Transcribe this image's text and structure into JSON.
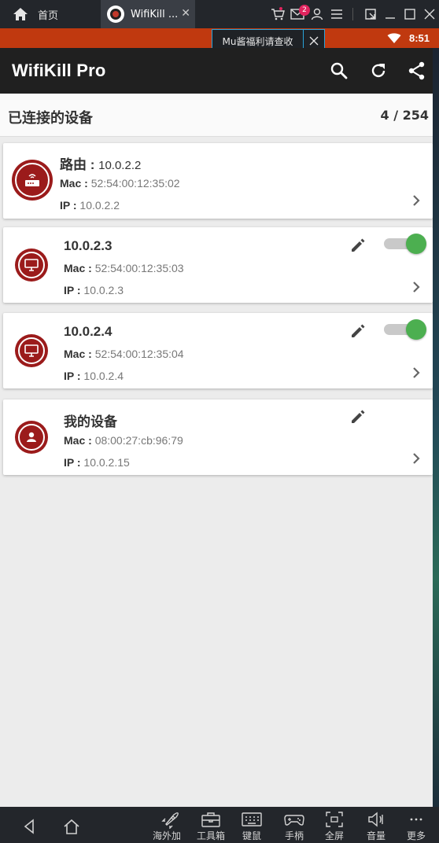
{
  "emulator": {
    "home_tab_label": "首页",
    "app_tab_label": "WifiKill ...",
    "mail_badge": "2",
    "promo_text": "Mu酱福利请查收"
  },
  "status_bar": {
    "time": "8:51"
  },
  "toolbar": {
    "title": "WifiKill Pro"
  },
  "section": {
    "title": "已连接的设备",
    "count": "4 / 254"
  },
  "devices": [
    {
      "title_label": "路由 : ",
      "title": "10.0.2.2",
      "mac_label": "Mac : ",
      "mac": "52:54:00:12:35:02",
      "ip_label": "IP : ",
      "ip": "10.0.2.2",
      "icon": "router-icon"
    },
    {
      "title": "10.0.2.3",
      "mac_label": "Mac : ",
      "mac": "52:54:00:12:35:03",
      "ip_label": "IP : ",
      "ip": "10.0.2.3",
      "icon": "monitor-icon",
      "enabled": true
    },
    {
      "title": "10.0.2.4",
      "mac_label": "Mac : ",
      "mac": "52:54:00:12:35:04",
      "ip_label": "IP : ",
      "ip": "10.0.2.4",
      "icon": "monitor-icon",
      "enabled": true
    },
    {
      "title": "我的设备",
      "mac_label": "Mac : ",
      "mac": "08:00:27:cb:96:79",
      "ip_label": "IP : ",
      "ip": "10.0.2.15",
      "icon": "person-icon"
    }
  ],
  "bottom_bar": {
    "tools": [
      "海外加速",
      "工具箱",
      "键鼠",
      "手柄",
      "全屏",
      "音量",
      "更多"
    ]
  },
  "colors": {
    "status_bar": "#c0390f",
    "toolbar": "#202020",
    "avatar": "#9b1b1b",
    "toggle_on": "#4caf50",
    "promo_border": "#29a3d9"
  }
}
